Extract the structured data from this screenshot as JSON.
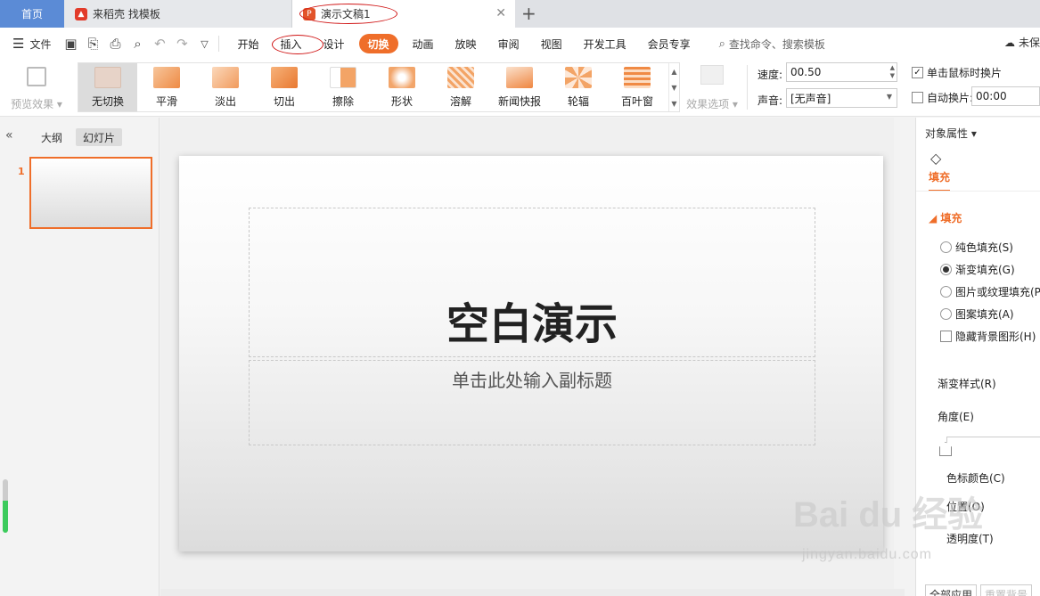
{
  "tabs": {
    "home": "首页",
    "docer": "来稻壳 找模板",
    "document": "演示文稿1"
  },
  "menu": {
    "file": "文件",
    "items": [
      "开始",
      "插入",
      "设计",
      "切换",
      "动画",
      "放映",
      "审阅",
      "视图",
      "开发工具",
      "会员专享"
    ],
    "active": "切换",
    "search": "查找命令、搜索模板",
    "cloud": "未保"
  },
  "ribbon": {
    "preview": "预览效果",
    "transitions": [
      "无切换",
      "平滑",
      "淡出",
      "切出",
      "擦除",
      "形状",
      "溶解",
      "新闻快报",
      "轮辐",
      "百叶窗"
    ],
    "selected": "无切换",
    "effect_options": "效果选项",
    "speed_label": "速度:",
    "speed_value": "00.50",
    "sound_label": "声音:",
    "sound_value": "[无声音]",
    "on_click_label": "单击鼠标时换片",
    "on_click_checked": true,
    "auto_label": "自动换片:",
    "auto_value": "00:00",
    "auto_checked": false
  },
  "left_panel": {
    "outline_tab": "大纲",
    "slides_tab": "幻灯片",
    "slide_number": "1"
  },
  "slide": {
    "title": "空白演示",
    "subtitle": "单击此处输入副标题"
  },
  "right_panel": {
    "header": "对象属性",
    "tab": "填充",
    "section": "填充",
    "fill_options": [
      "纯色填充(S)",
      "渐变填充(G)",
      "图片或纹理填充(P",
      "图案填充(A)"
    ],
    "selected_fill": "渐变填充(G)",
    "hide_bg": "隐藏背景图形(H)",
    "gradient_style": "渐变样式(R)",
    "angle": "角度(E)",
    "stop_color": "色标颜色(C)",
    "position": "位置(O)",
    "transparency": "透明度(T)",
    "apply_all": "全部应用",
    "reset_bg": "重置背景"
  },
  "watermark": {
    "brand": "Bai du 经验",
    "url": "jingyan.baidu.com"
  },
  "colors": {
    "accent": "#ef6e2a",
    "home_tab": "#5b8bd6",
    "annotation": "#d01616"
  }
}
